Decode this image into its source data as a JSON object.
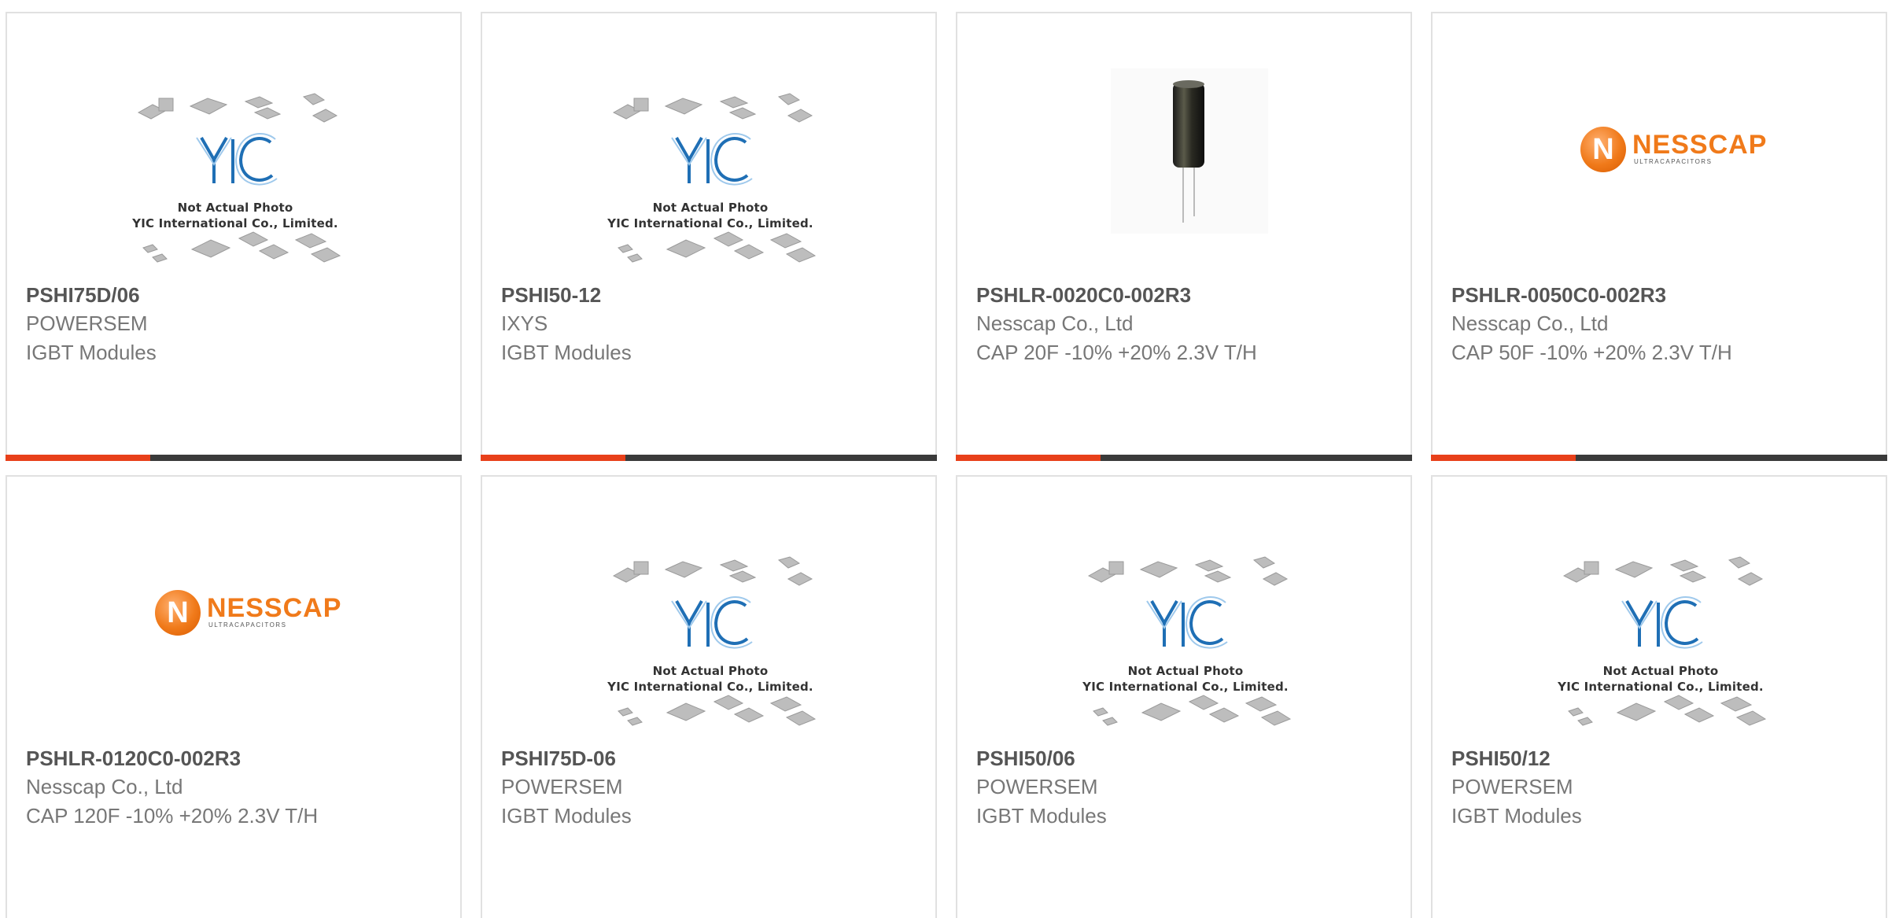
{
  "placeholder": {
    "line1": "Not Actual Photo",
    "line2": "YIC International Co., Limited."
  },
  "logo": {
    "nesscap_letter": "N",
    "nesscap_name": "NESSCAP",
    "nesscap_sub": "ULTRACAPACITORS"
  },
  "colors": {
    "accent": "#e8401a",
    "bar": "#3a3a3a",
    "yic_blue": "#1f6fb5",
    "nesscap_orange": "#f07a1a"
  },
  "products": [
    {
      "part": "PSHI75D/06",
      "manufacturer": "POWERSEM",
      "description": "IGBT Modules",
      "image": "yic-placeholder"
    },
    {
      "part": "PSHI50-12",
      "manufacturer": "IXYS",
      "description": "IGBT Modules",
      "image": "yic-placeholder"
    },
    {
      "part": "PSHLR-0020C0-002R3",
      "manufacturer": "Nesscap Co., Ltd",
      "description": "CAP 20F -10% +20% 2.3V T/H",
      "image": "capacitor-photo"
    },
    {
      "part": "PSHLR-0050C0-002R3",
      "manufacturer": "Nesscap Co., Ltd",
      "description": "CAP 50F -10% +20% 2.3V T/H",
      "image": "nesscap-logo"
    },
    {
      "part": "PSHLR-0120C0-002R3",
      "manufacturer": "Nesscap Co., Ltd",
      "description": "CAP 120F -10% +20% 2.3V T/H",
      "image": "nesscap-logo"
    },
    {
      "part": "PSHI75D-06",
      "manufacturer": "POWERSEM",
      "description": "IGBT Modules",
      "image": "yic-placeholder"
    },
    {
      "part": "PSHI50/06",
      "manufacturer": "POWERSEM",
      "description": "IGBT Modules",
      "image": "yic-placeholder"
    },
    {
      "part": "PSHI50/12",
      "manufacturer": "POWERSEM",
      "description": "IGBT Modules",
      "image": "yic-placeholder"
    }
  ]
}
